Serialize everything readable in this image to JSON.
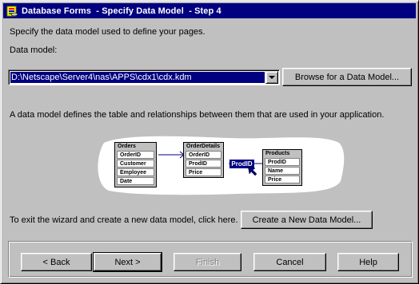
{
  "window": {
    "title": "Database Forms  - Specify Data Model  - Step 4",
    "title_icon": "database-forms-app-icon"
  },
  "main": {
    "instruction": "Specify the data model used to define your pages.",
    "data_model_label": "Data model:",
    "data_model_value": "D:\\Netscape\\Server4\\nas\\APPS\\cdx1\\cdx.kdm",
    "browse_button": "Browse for a Data Model...",
    "description": "A data model defines the table and relationships between them that are used in your application.",
    "exit_text": "To exit the wizard and create a new data model, click here.",
    "create_button": "Create a New Data Model..."
  },
  "diagram": {
    "tables": [
      {
        "name": "Orders",
        "fields": [
          "OrderID",
          "Customer",
          "Employee",
          "Date"
        ]
      },
      {
        "name": "OrderDetails",
        "fields": [
          "OrderID",
          "ProdID",
          "Price"
        ]
      },
      {
        "name": "Products",
        "fields": [
          "ProdID",
          "Name",
          "Price"
        ]
      }
    ],
    "relation_label": "ProdID"
  },
  "footer": {
    "back": "< Back",
    "next": "Next >",
    "finish": "Finish",
    "cancel": "Cancel",
    "help": "Help"
  },
  "colors": {
    "titlebar": "#000080",
    "face": "#c0c0c0",
    "selection": "#000080"
  }
}
